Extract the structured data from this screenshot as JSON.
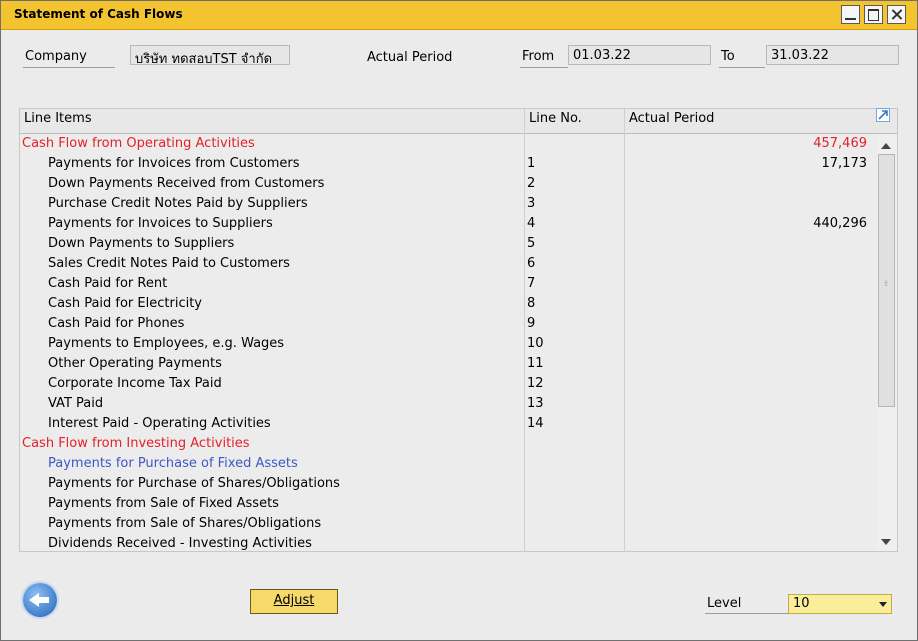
{
  "window": {
    "title": "Statement of Cash Flows"
  },
  "header": {
    "company_label": "Company",
    "company_value": "บริษัท ทดสอบTST จำกัด",
    "period_label": "Actual Period",
    "from_label": "From",
    "from_value": "01.03.22",
    "to_label": "To",
    "to_value": "31.03.22"
  },
  "grid": {
    "columns": [
      "Line Items",
      "Line No.",
      "Actual Period"
    ],
    "rows": [
      {
        "item": "Cash Flow from Operating Activities",
        "no": "",
        "amount": "457,469"
      },
      {
        "item": "Payments for Invoices from Customers",
        "no": "1",
        "amount": "17,173"
      },
      {
        "item": "Down Payments Received from Customers",
        "no": "2",
        "amount": ""
      },
      {
        "item": "Purchase Credit Notes Paid by Suppliers",
        "no": "3",
        "amount": ""
      },
      {
        "item": "Payments for Invoices to Suppliers",
        "no": "4",
        "amount": "440,296"
      },
      {
        "item": "Down Payments to Suppliers",
        "no": "5",
        "amount": ""
      },
      {
        "item": "Sales Credit Notes Paid to Customers",
        "no": "6",
        "amount": ""
      },
      {
        "item": "Cash Paid for Rent",
        "no": "7",
        "amount": ""
      },
      {
        "item": "Cash Paid for Electricity",
        "no": "8",
        "amount": ""
      },
      {
        "item": "Cash Paid for Phones",
        "no": "9",
        "amount": ""
      },
      {
        "item": "Payments to Employees, e.g. Wages",
        "no": "10",
        "amount": ""
      },
      {
        "item": "Other Operating Payments",
        "no": "11",
        "amount": ""
      },
      {
        "item": "Corporate Income Tax Paid",
        "no": "12",
        "amount": ""
      },
      {
        "item": "VAT Paid",
        "no": "13",
        "amount": ""
      },
      {
        "item": "Interest Paid - Operating Activities",
        "no": "14",
        "amount": ""
      },
      {
        "item": "Cash Flow from Investing Activities",
        "no": "",
        "amount": ""
      },
      {
        "item": "Payments for Purchase of Fixed Assets",
        "no": "",
        "amount": ""
      },
      {
        "item": "Payments for Purchase of Shares/Obligations",
        "no": "",
        "amount": ""
      },
      {
        "item": "Payments from Sale of Fixed Assets",
        "no": "",
        "amount": ""
      },
      {
        "item": "Payments from Sale of Shares/Obligations",
        "no": "",
        "amount": ""
      },
      {
        "item": "Dividends Received - Investing Activities",
        "no": "",
        "amount": ""
      }
    ]
  },
  "footer": {
    "adjust_label": "Adjust",
    "level_label": "Level",
    "level_value": "10"
  },
  "colors": {
    "title_bar": "#f4c430",
    "section_text": "#e4202c",
    "highlight_text": "#3d57c7",
    "button_fill": "#f7d86a",
    "dropdown_fill": "#fbee9a"
  },
  "icons": [
    "minimize-icon",
    "maximize-icon",
    "close-icon",
    "expand-arrow-icon",
    "back-arrow-icon",
    "chevron-down-icon"
  ]
}
